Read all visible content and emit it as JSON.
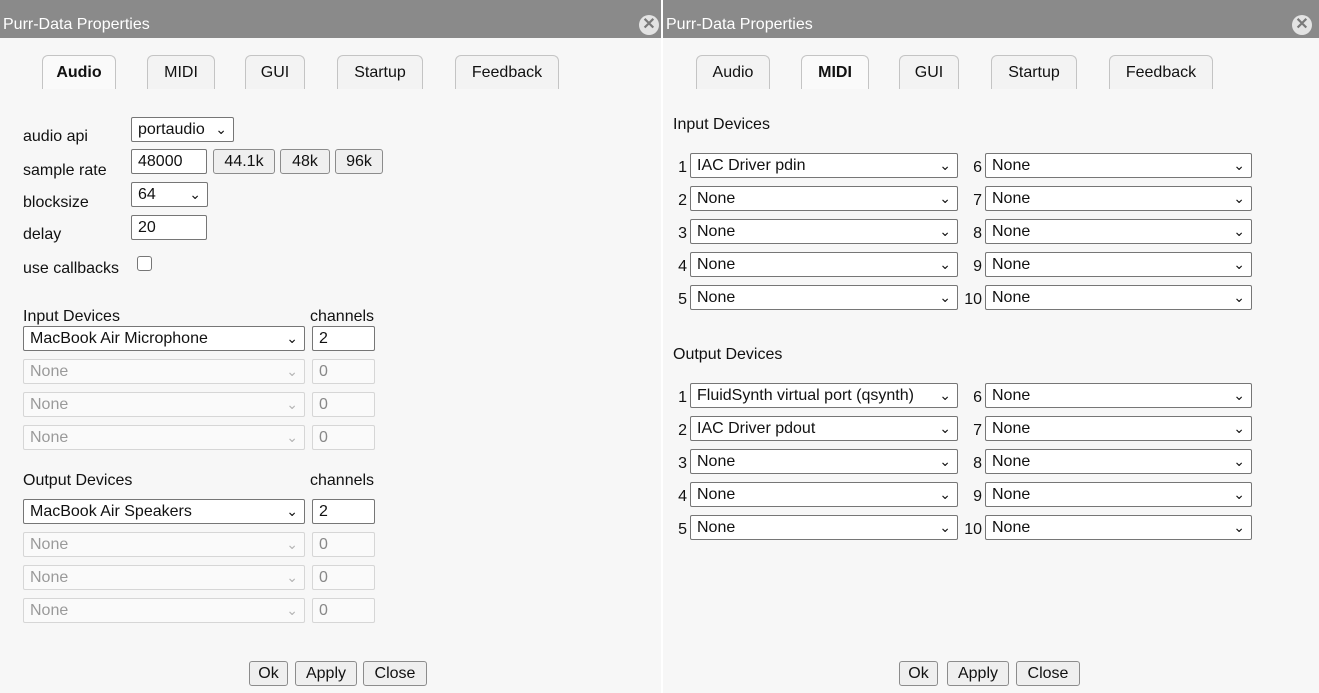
{
  "left": {
    "title": "Purr-Data Properties",
    "close_glyph": "✕",
    "tabs": [
      "Audio",
      "MIDI",
      "GUI",
      "Startup",
      "Feedback"
    ],
    "active_tab": "Audio",
    "audio_api_label": "audio api",
    "audio_api_value": "portaudio",
    "sample_rate_label": "sample rate",
    "sample_rate_value": "48000",
    "rate_buttons": [
      "44.1k",
      "48k",
      "96k"
    ],
    "blocksize_label": "blocksize",
    "blocksize_value": "64",
    "delay_label": "delay",
    "delay_value": "20",
    "callbacks_label": "use callbacks",
    "input_devices_label": "Input Devices",
    "output_devices_label": "Output Devices",
    "channels_label": "channels",
    "input_devices": [
      {
        "device": "MacBook Air Microphone",
        "channels": "2",
        "enabled": true
      },
      {
        "device": "None",
        "channels": "0",
        "enabled": false
      },
      {
        "device": "None",
        "channels": "0",
        "enabled": false
      },
      {
        "device": "None",
        "channels": "0",
        "enabled": false
      }
    ],
    "output_devices": [
      {
        "device": "MacBook Air Speakers",
        "channels": "2",
        "enabled": true
      },
      {
        "device": "None",
        "channels": "0",
        "enabled": false
      },
      {
        "device": "None",
        "channels": "0",
        "enabled": false
      },
      {
        "device": "None",
        "channels": "0",
        "enabled": false
      }
    ],
    "buttons": {
      "ok": "Ok",
      "apply": "Apply",
      "close": "Close"
    }
  },
  "right": {
    "title": "Purr-Data Properties",
    "close_glyph": "✕",
    "tabs": [
      "Audio",
      "MIDI",
      "GUI",
      "Startup",
      "Feedback"
    ],
    "active_tab": "MIDI",
    "input_devices_label": "Input Devices",
    "output_devices_label": "Output Devices",
    "input_devices": [
      {
        "num": "1",
        "device": "IAC Driver pdin"
      },
      {
        "num": "2",
        "device": "None"
      },
      {
        "num": "3",
        "device": "None"
      },
      {
        "num": "4",
        "device": "None"
      },
      {
        "num": "5",
        "device": "None"
      },
      {
        "num": "6",
        "device": "None"
      },
      {
        "num": "7",
        "device": "None"
      },
      {
        "num": "8",
        "device": "None"
      },
      {
        "num": "9",
        "device": "None"
      },
      {
        "num": "10",
        "device": "None"
      }
    ],
    "output_devices": [
      {
        "num": "1",
        "device": "FluidSynth virtual port (qsynth)"
      },
      {
        "num": "2",
        "device": "IAC Driver pdout"
      },
      {
        "num": "3",
        "device": "None"
      },
      {
        "num": "4",
        "device": "None"
      },
      {
        "num": "5",
        "device": "None"
      },
      {
        "num": "6",
        "device": "None"
      },
      {
        "num": "7",
        "device": "None"
      },
      {
        "num": "8",
        "device": "None"
      },
      {
        "num": "9",
        "device": "None"
      },
      {
        "num": "10",
        "device": "None"
      }
    ],
    "buttons": {
      "ok": "Ok",
      "apply": "Apply",
      "close": "Close"
    }
  },
  "chevron_glyph": "⌄"
}
